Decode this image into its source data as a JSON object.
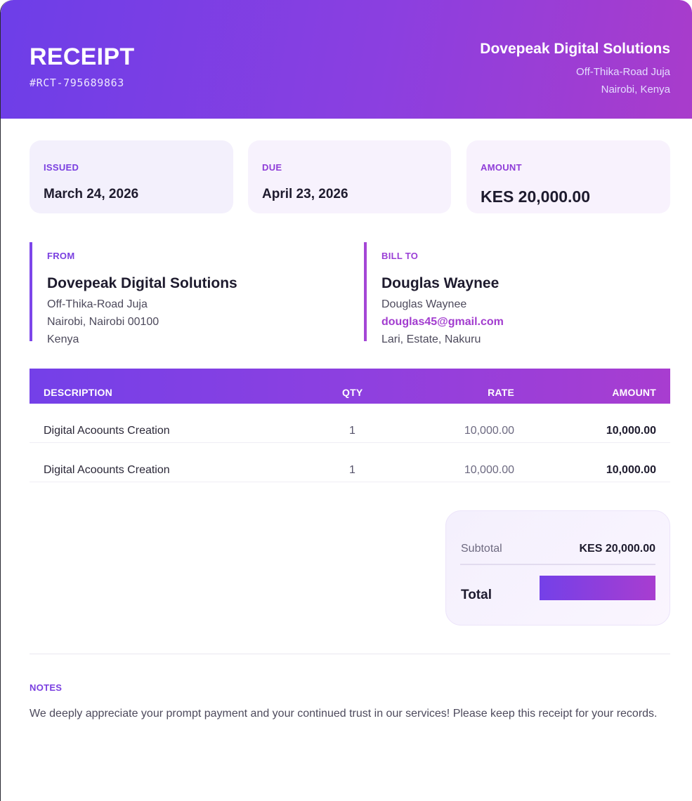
{
  "header": {
    "title": "RECEIPT",
    "receipt_number": "#RCT-795689863",
    "company_name": "Dovepeak Digital Solutions",
    "company_address_line1": "Off-Thika-Road Juja",
    "company_address_line2": "Nairobi, Kenya",
    "background_colors": [
      "#6d3ee8",
      "#a93ccb"
    ]
  },
  "summary_cards": {
    "issued": {
      "label": "ISSUED",
      "value": "March 24, 2026"
    },
    "due": {
      "label": "DUE",
      "value": "April 23, 2026"
    },
    "amount": {
      "label": "AMOUNT",
      "value": "KES 20,000.00"
    }
  },
  "from": {
    "label": "FROM",
    "name": "Dovepeak Digital Solutions",
    "line1": "Off-Thika-Road Juja",
    "line2": "Nairobi, Nairobi 00100",
    "line3": "Kenya"
  },
  "bill_to": {
    "label": "BILL TO",
    "name": "Douglas Waynee",
    "line1": "Douglas Waynee",
    "email": "douglas45@gmail.com",
    "line3": "Lari, Estate, Nakuru"
  },
  "items_table": {
    "headers": {
      "description": "DESCRIPTION",
      "qty": "QTY",
      "rate": "RATE",
      "amount": "AMOUNT"
    },
    "rows": [
      {
        "description": "Digital Acoounts Creation",
        "qty": "1",
        "rate": "10,000.00",
        "amount": "10,000.00"
      },
      {
        "description": "Digital Acoounts Creation",
        "qty": "1",
        "rate": "10,000.00",
        "amount": "10,000.00"
      }
    ]
  },
  "totals": {
    "subtotal_label": "Subtotal",
    "subtotal_value": "KES 20,000.00",
    "total_label": "Total"
  },
  "notes": {
    "label": "NOTES",
    "text": "We deeply appreciate your prompt payment and your continued trust in our services! Please keep this receipt for your records."
  },
  "colors": {
    "accent_primary": "#7a3fe0",
    "accent_secondary": "#a23ccf"
  }
}
